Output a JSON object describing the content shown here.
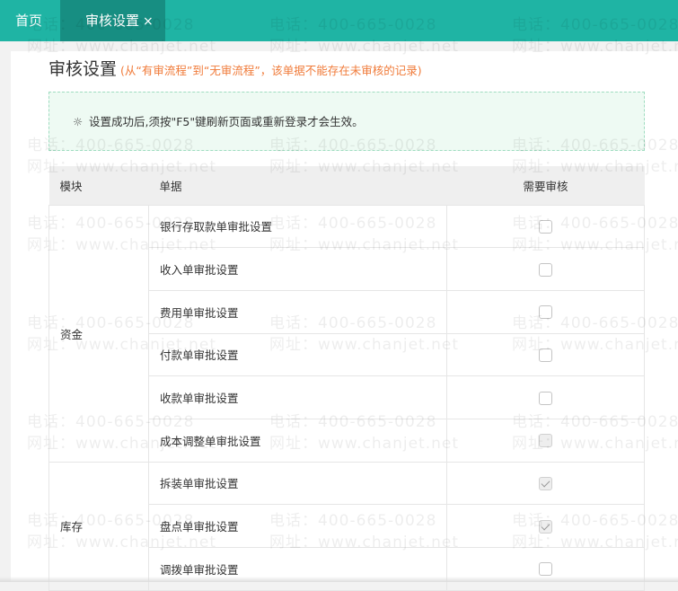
{
  "tabs": [
    {
      "label": "首页"
    },
    {
      "label": "审核设置",
      "close": "×"
    }
  ],
  "page": {
    "title": "审核设置",
    "note": "(从“有审流程”到“无审流程”，该单据不能存在未审核的记录)"
  },
  "notice": {
    "icon": "lightbulb-icon",
    "text": "设置成功后,须按\"F5\"键刷新页面或重新登录才会生效。"
  },
  "table": {
    "headers": [
      "模块",
      "单据",
      "需要审核"
    ],
    "groups": [
      {
        "module": "资金",
        "rows": [
          {
            "doc": "银行存取款单审批设置",
            "checked": false,
            "disabled": false
          },
          {
            "doc": "收入单审批设置",
            "checked": false,
            "disabled": false
          },
          {
            "doc": "费用单审批设置",
            "checked": false,
            "disabled": false
          },
          {
            "doc": "付款单审批设置",
            "checked": false,
            "disabled": false
          },
          {
            "doc": "收款单审批设置",
            "checked": false,
            "disabled": false
          },
          {
            "doc": "成本调整单审批设置",
            "checked": false,
            "disabled": true
          }
        ]
      },
      {
        "module": "库存",
        "rows": [
          {
            "doc": "拆装单审批设置",
            "checked": true,
            "disabled": true
          },
          {
            "doc": "盘点单审批设置",
            "checked": true,
            "disabled": true
          },
          {
            "doc": "调拨单审批设置",
            "checked": false,
            "disabled": false
          }
        ]
      }
    ]
  },
  "watermark": {
    "phone": "电话：400-665-0028",
    "site": "网址：www.chanjet.net"
  }
}
